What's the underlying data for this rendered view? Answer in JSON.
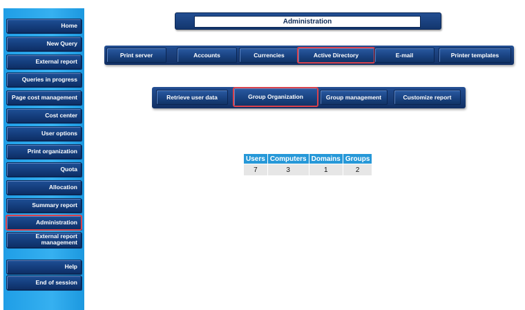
{
  "sidebar": {
    "items": [
      {
        "label": "Home"
      },
      {
        "label": "New Query"
      },
      {
        "label": "External report"
      },
      {
        "label": "Queries in progress"
      },
      {
        "label": "Page cost management"
      },
      {
        "label": "Cost center"
      },
      {
        "label": "User options"
      },
      {
        "label": "Print organization"
      },
      {
        "label": "Quota"
      },
      {
        "label": "Allocation"
      },
      {
        "label": "Summary report"
      },
      {
        "label": "Administration"
      },
      {
        "label_line1": "External report",
        "label_line2": "management"
      }
    ],
    "bottom_items": [
      {
        "label": "Help"
      },
      {
        "label": "End of session"
      }
    ]
  },
  "header": {
    "title": "Administration"
  },
  "main_tabs": [
    {
      "label": "Print server"
    },
    {
      "label": "Accounts"
    },
    {
      "label": "Currencies"
    },
    {
      "label": "Active Directory"
    },
    {
      "label": "E-mail"
    },
    {
      "label": "Printer templates"
    }
  ],
  "sub_tabs": [
    {
      "label": "Retrieve user data"
    },
    {
      "label": "Group Organization"
    },
    {
      "label": "Group management"
    },
    {
      "label": "Customize report"
    }
  ],
  "stats": {
    "headers": [
      "Users",
      "Computers",
      "Domains",
      "Groups"
    ],
    "values": [
      "7",
      "3",
      "1",
      "2"
    ]
  },
  "colors": {
    "sidebar_bg": "#2aa6ec",
    "button_navy": "#163f7d",
    "highlight_red": "#d9414b",
    "table_header": "#2698d8"
  }
}
